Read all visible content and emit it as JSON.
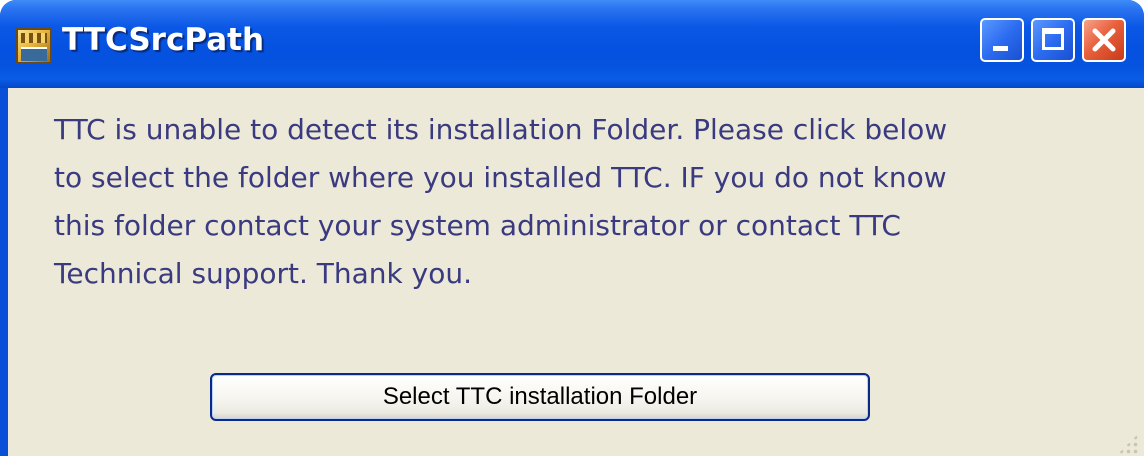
{
  "window": {
    "title": "TTCSrcPath",
    "icon": "ttc-app-icon",
    "controls": {
      "minimize": "minimize-icon",
      "maximize": "maximize-icon",
      "close": "close-icon"
    },
    "colors": {
      "title_bar": "#0552e0",
      "client_background": "#ece9d8",
      "message_text": "#3a3a80",
      "close_button": "#e8603c"
    }
  },
  "message": {
    "lines": [
      "TTC is unable to detect its installation Folder. Please click below",
      "to select the folder where you installed TTC. IF you do not know",
      "this folder contact your system administrator or contact TTC",
      "Technical support. Thank you."
    ]
  },
  "actions": {
    "select_folder_label": "Select TTC installation Folder"
  }
}
